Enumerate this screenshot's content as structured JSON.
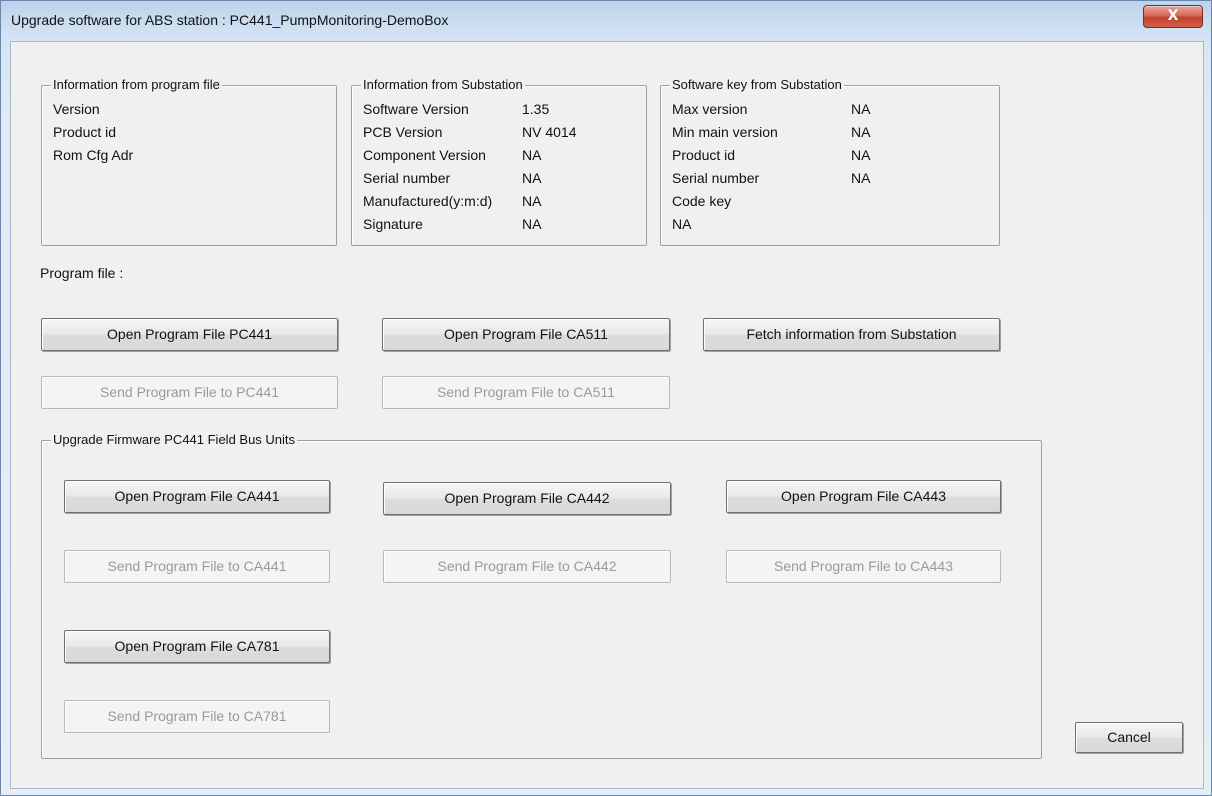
{
  "window": {
    "title": "Upgrade software for ABS station : PC441_PumpMonitoring-DemoBox",
    "close_glyph": "X"
  },
  "program_file_info": {
    "legend": "Information from program file",
    "labels": [
      "Version",
      "Product id",
      "Rom Cfg Adr"
    ]
  },
  "substation_info": {
    "legend": "Information from Substation",
    "rows": [
      {
        "label": "Software Version",
        "value": "1.35"
      },
      {
        "label": "PCB Version",
        "value": "NV 4014"
      },
      {
        "label": "Component Version",
        "value": "NA"
      },
      {
        "label": "Serial number",
        "value": "NA"
      },
      {
        "label": "Manufactured(y:m:d)",
        "value": "NA"
      },
      {
        "label": "Signature",
        "value": "NA"
      }
    ]
  },
  "software_key": {
    "legend": "Software key from Substation",
    "rows": [
      {
        "label": "Max version",
        "value": "NA"
      },
      {
        "label": "Min main version",
        "value": "NA"
      },
      {
        "label": "Product id",
        "value": "NA"
      },
      {
        "label": "Serial number",
        "value": "NA"
      }
    ],
    "code_key_label": "Code key",
    "code_key_value": "NA"
  },
  "program_file_label": "Program file :",
  "buttons": {
    "open_pc441": "Open Program File PC441",
    "open_ca511": "Open Program File CA511",
    "fetch_info": "Fetch information from Substation",
    "send_pc441": "Send Program File to PC441",
    "send_ca511": "Send Program File to CA511",
    "cancel": "Cancel"
  },
  "fieldbus": {
    "legend": "Upgrade Firmware PC441 Field Bus Units",
    "open_ca441": "Open Program File CA441",
    "open_ca442": "Open Program File CA442",
    "open_ca443": "Open Program File CA443",
    "send_ca441": "Send Program File to CA441",
    "send_ca442": "Send Program File to CA442",
    "send_ca443": "Send Program File to CA443",
    "open_ca781": "Open Program File CA781",
    "send_ca781": "Send Program File to CA781"
  },
  "colors": {
    "close_button": "#c94a38",
    "disabled_text": "#9a9a9a",
    "dialog_bg": "#f0f0f0"
  }
}
